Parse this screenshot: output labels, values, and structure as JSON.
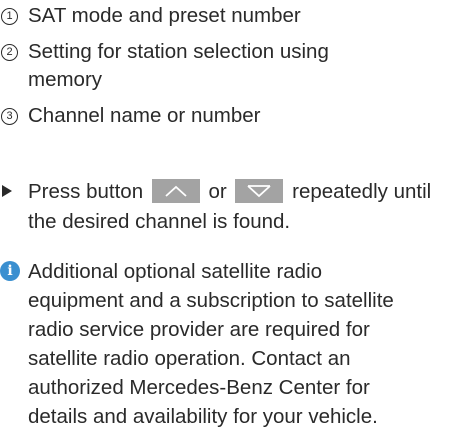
{
  "legend": [
    {
      "number": "1",
      "lines": [
        "SAT mode and preset number"
      ]
    },
    {
      "number": "2",
      "lines": [
        "Setting for station selection using",
        "memory"
      ]
    },
    {
      "number": "3",
      "lines": [
        "Channel name or number"
      ]
    }
  ],
  "instruction": {
    "before_up": "Press button",
    "between": "or",
    "after_down": "repeatedly until",
    "line2": "the desired channel is found.",
    "up_key_icon": "arrow-up",
    "down_key_icon": "arrow-down"
  },
  "note": {
    "icon": "info-icon",
    "lines": [
      "Additional optional satellite radio",
      "equipment and a subscription to satellite",
      "radio service provider are required for",
      "satellite radio operation. Contact an",
      "authorized Mercedes-Benz Center for",
      "details and availability for your vehicle."
    ]
  },
  "colors": {
    "text": "#2a2a2a",
    "key_background": "#a3a3a3",
    "info_icon": "#3a8fd0"
  }
}
